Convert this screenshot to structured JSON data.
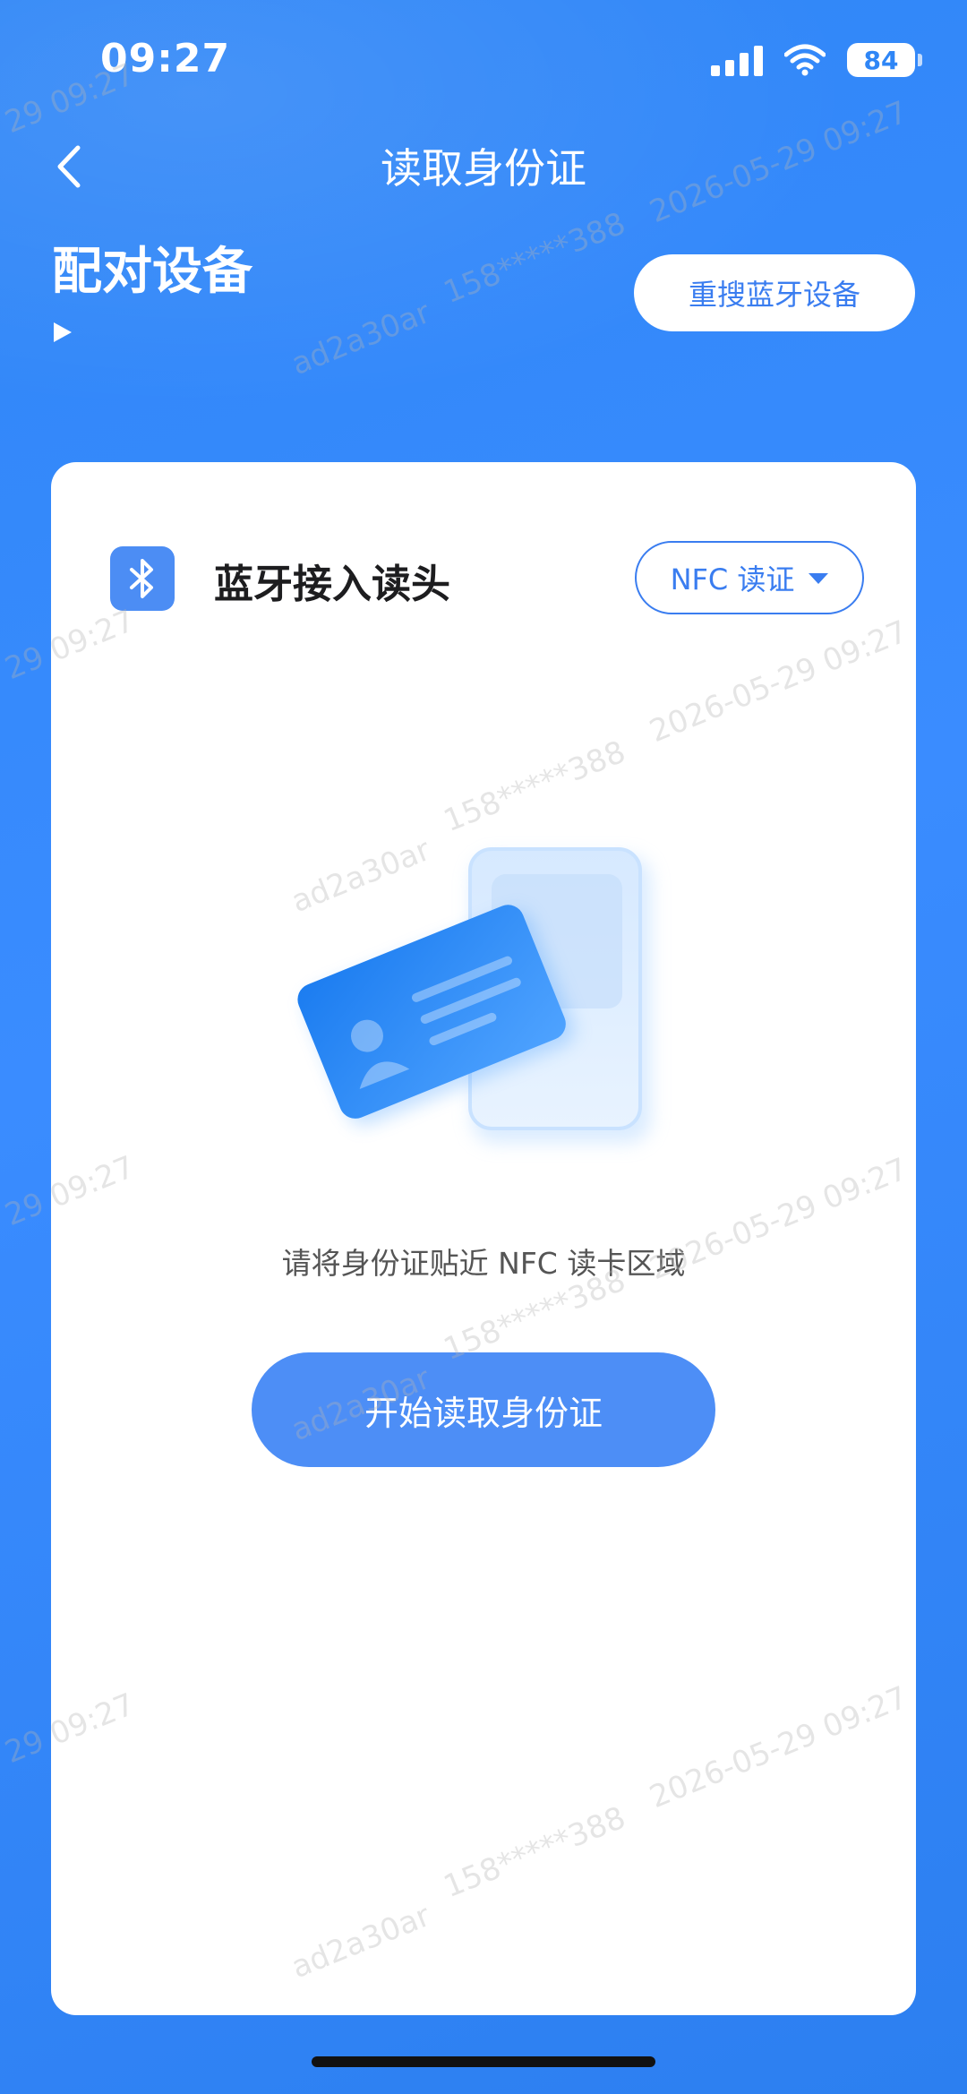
{
  "status_bar": {
    "time": "09:27",
    "battery": "84"
  },
  "nav": {
    "title": "读取身份证"
  },
  "pair": {
    "title": "配对设备",
    "rescan_label": "重搜蓝牙设备"
  },
  "card": {
    "reader_label": "蓝牙接入读头",
    "mode_label": "NFC 读证",
    "hint": "请将身份证贴近 NFC 读卡区域",
    "start_label": "开始读取身份证"
  },
  "watermark": {
    "line1": "2026-05-29 09:27",
    "line2": "158*****388",
    "line3": "ad2a30ar",
    "fragment": "29 09:27"
  },
  "colors": {
    "accent": "#3a7df0",
    "button": "#4d8ef6",
    "background": "#2f86f6"
  },
  "icons": [
    "back-icon",
    "signal-icon",
    "wifi-icon",
    "battery-icon",
    "play-triangle-icon",
    "bluetooth-icon",
    "caret-down-icon"
  ]
}
